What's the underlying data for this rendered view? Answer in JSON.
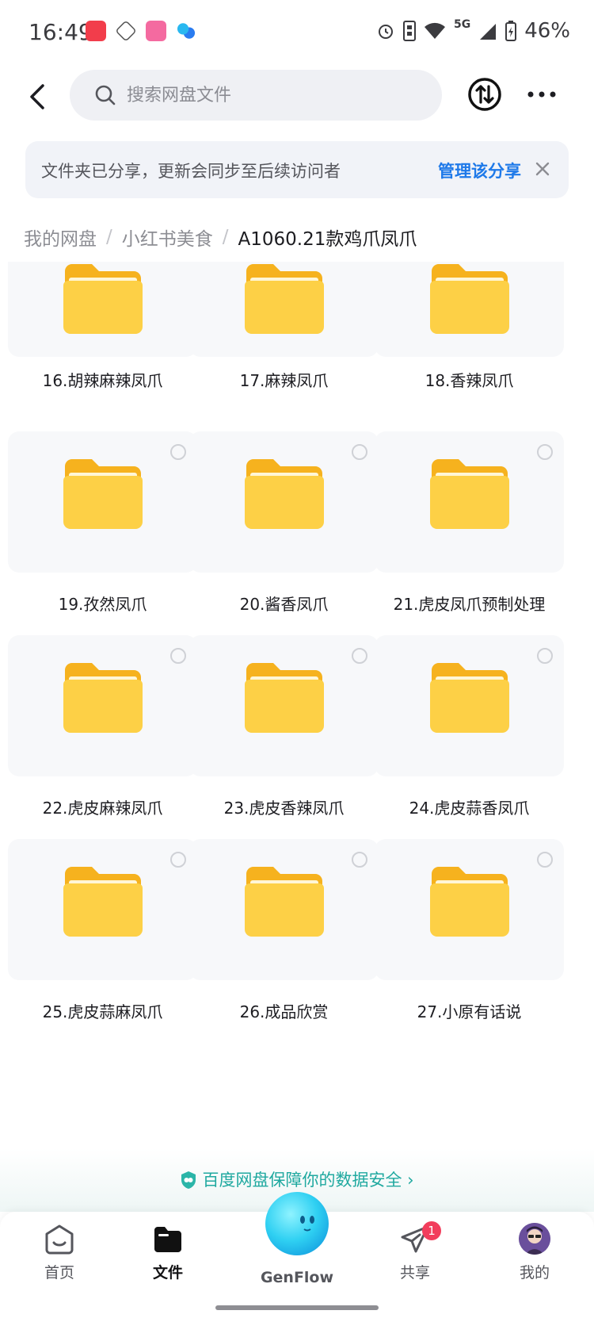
{
  "status_bar": {
    "time": "16:49",
    "battery": "46%",
    "network": "5G"
  },
  "search": {
    "placeholder": "搜索网盘文件"
  },
  "notice": {
    "message": "文件夹已分享，更新会同步至后续访问者",
    "manage_label": "管理该分享"
  },
  "breadcrumb": [
    "我的网盘",
    "小红书美食",
    "A1060.21款鸡爪凤爪"
  ],
  "folders": [
    {
      "name": "16.胡辣麻辣凤爪"
    },
    {
      "name": "17.麻辣凤爪"
    },
    {
      "name": "18.香辣凤爪"
    },
    {
      "name": "19.孜然凤爪"
    },
    {
      "name": "20.酱香凤爪"
    },
    {
      "name": "21.虎皮凤爪预制处理"
    },
    {
      "name": "22.虎皮麻辣凤爪"
    },
    {
      "name": "23.虎皮香辣凤爪"
    },
    {
      "name": "24.虎皮蒜香凤爪"
    },
    {
      "name": "25.虎皮蒜麻凤爪"
    },
    {
      "name": "26.成品欣赏"
    },
    {
      "name": "27.小原有话说"
    }
  ],
  "safety_text": "百度网盘保障你的数据安全",
  "tabs": [
    {
      "label": "首页",
      "icon": "home-icon"
    },
    {
      "label": "文件",
      "icon": "folder-icon",
      "active": true
    },
    {
      "label": "GenFlow",
      "icon": "genflow-icon"
    },
    {
      "label": "共享",
      "icon": "share-icon",
      "badge": "1"
    },
    {
      "label": "我的",
      "icon": "avatar"
    }
  ],
  "colors": {
    "accent": "#1e79e9",
    "folder": "#fcc72e",
    "badge": "#f23d5c",
    "safety": "#20a9a0"
  }
}
